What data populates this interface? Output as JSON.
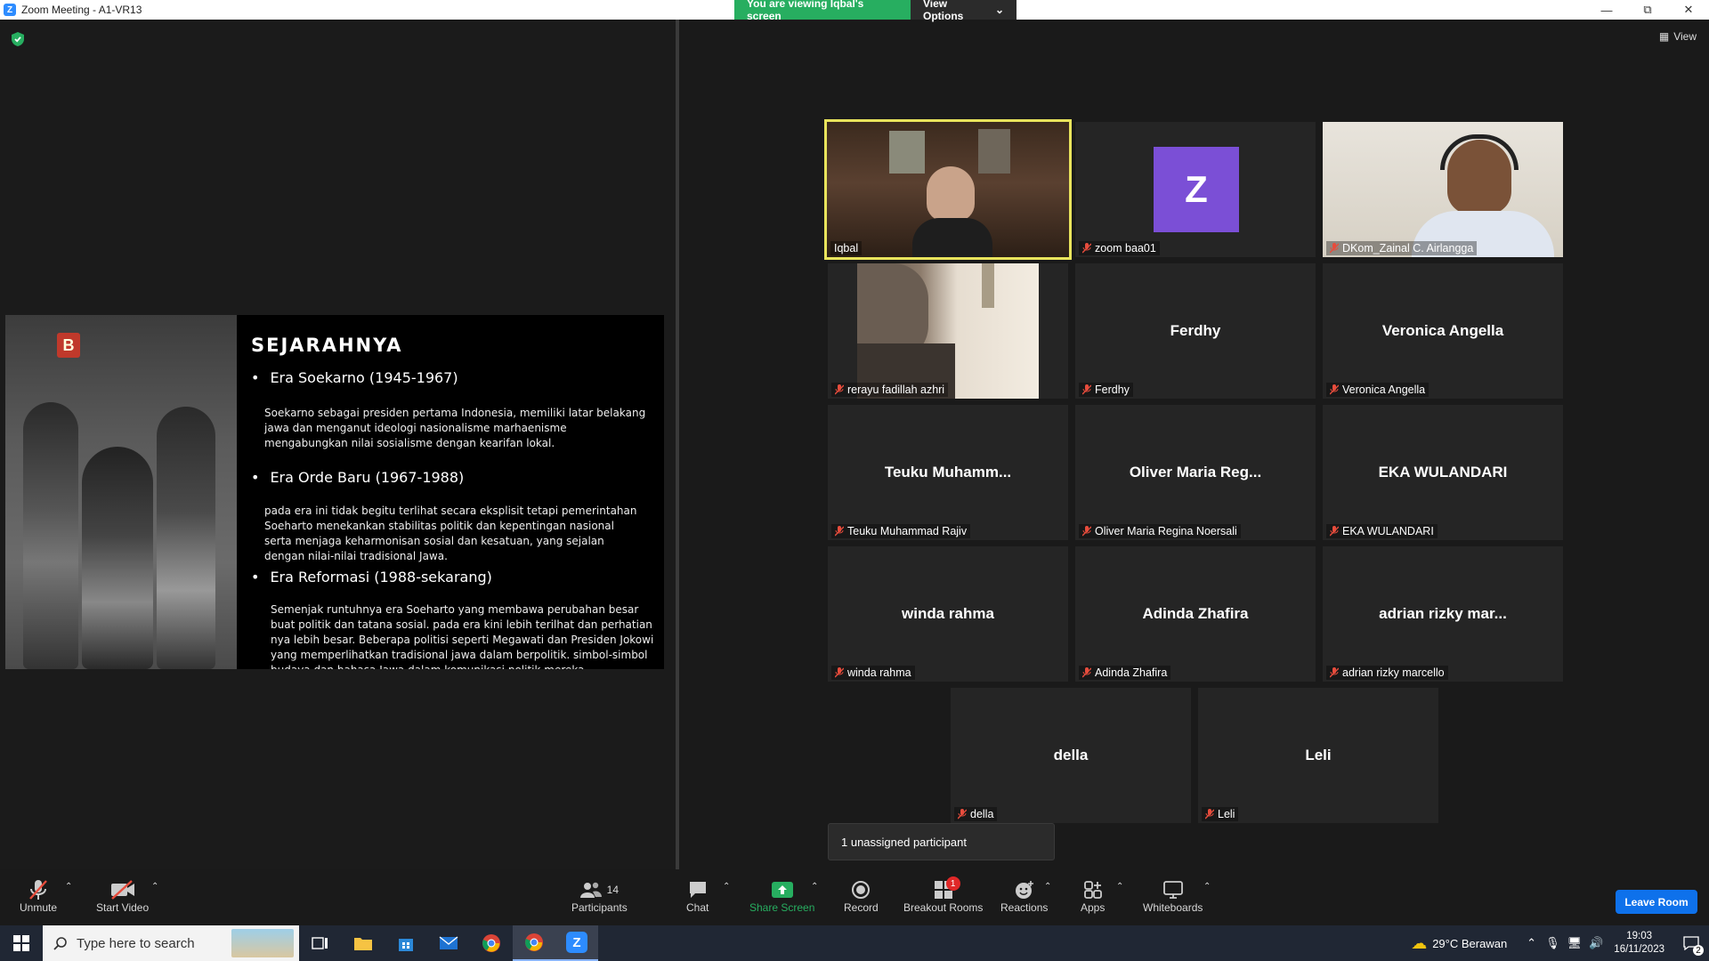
{
  "window": {
    "title": "Zoom Meeting - A1-VR13",
    "logo_letter": "Z"
  },
  "banner": {
    "viewing": "You are viewing Iqbal's screen",
    "view_options": "View Options"
  },
  "view_button": "View",
  "slide": {
    "logo_letter": "B",
    "title": "SEJARAHNYA",
    "eras": [
      {
        "heading": "Era Soekarno (1945-1967)",
        "desc": "Soekarno sebagai presiden pertama Indonesia, memiliki latar belakang jawa dan menganut ideologi nasionalisme marhaenisme mengabungkan nilai sosialisme dengan kearifan lokal."
      },
      {
        "heading": "Era Orde Baru (1967-1988)",
        "desc": "pada era ini tidak begitu terlihat secara eksplisit tetapi pemerintahan Soeharto menekankan stabilitas politik dan kepentingan nasional serta menjaga keharmonisan sosial dan kesatuan, yang sejalan dengan nilai-nilai tradisional Jawa."
      },
      {
        "heading": "Era Reformasi (1988-sekarang)",
        "desc": "Semenjak runtuhnya era Soeharto yang membawa perubahan besar buat politik dan tatana sosial. pada era kini lebih terilhat dan perhatian nya lebih besar. Beberapa politisi seperti Megawati dan Presiden Jokowi yang memperlihatkan  tradisional jawa dalam berpolitik. simbol-simbol budaya dan bahasa Jawa dalam komunikasi politik mereka."
      }
    ]
  },
  "participants": [
    {
      "name": "Iqbal",
      "display": "",
      "muted": false,
      "video": "room"
    },
    {
      "name": "zoom baa01",
      "display": "",
      "muted": true,
      "avatar": "Z"
    },
    {
      "name": "DKom_Zainal C. Airlangga",
      "display": "",
      "muted": true,
      "video": "man"
    },
    {
      "name": "rerayu fadillah azhri",
      "display": "",
      "muted": true,
      "video": "hijab"
    },
    {
      "name": "Ferdhy",
      "display": "Ferdhy",
      "muted": true
    },
    {
      "name": "Veronica Angella",
      "display": "Veronica Angella",
      "muted": true
    },
    {
      "name": "Teuku Muhammad Rajiv",
      "display": "Teuku  Muhamm...",
      "muted": true
    },
    {
      "name": "Oliver Maria Regina Noersali",
      "display": "Oliver Maria Reg...",
      "muted": true
    },
    {
      "name": "EKA WULANDARI",
      "display": "EKA WULANDARI",
      "muted": true
    },
    {
      "name": "winda rahma",
      "display": "winda rahma",
      "muted": true
    },
    {
      "name": "Adinda Zhafira",
      "display": "Adinda Zhafira",
      "muted": true
    },
    {
      "name": "adrian rizky marcello",
      "display": "adrian rizky mar...",
      "muted": true
    },
    {
      "name": "della",
      "display": "della",
      "muted": true
    },
    {
      "name": "Leli",
      "display": "Leli",
      "muted": true
    }
  ],
  "unassigned": "1 unassigned participant",
  "toolbar": {
    "unmute": "Unmute",
    "start_video": "Start Video",
    "participants": "Participants",
    "participants_count": "14",
    "chat": "Chat",
    "share_screen": "Share Screen",
    "record": "Record",
    "breakout_rooms": "Breakout Rooms",
    "breakout_badge": "1",
    "reactions": "Reactions",
    "apps": "Apps",
    "whiteboards": "Whiteboards",
    "leave": "Leave Room"
  },
  "taskbar": {
    "search_placeholder": "Type here to search",
    "weather": "29°C  Berawan",
    "time": "19:03",
    "date": "16/11/2023",
    "notifications": "2"
  },
  "colors": {
    "accent": "#0e71eb",
    "active_speaker": "#e9e45c",
    "banner_green": "#27ae60",
    "muted_red": "#e74c3c"
  }
}
